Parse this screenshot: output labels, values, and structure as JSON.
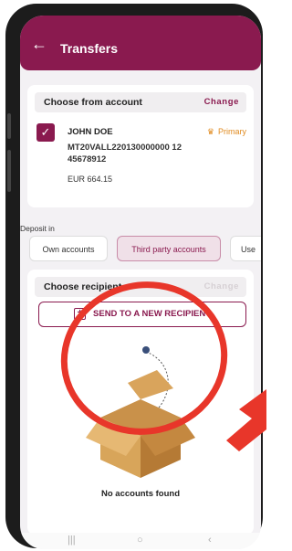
{
  "header": {
    "title": "Transfers"
  },
  "from_account": {
    "section_title": "Choose from account",
    "change_label": "Change",
    "name": "JOHN DOE",
    "iban": "MT20VALL220130000000 1245678912",
    "balance": "EUR 664.15",
    "primary_label": "Primary"
  },
  "deposit": {
    "label": "Deposit in",
    "tabs": [
      "Own accounts",
      "Third party accounts",
      "Use"
    ],
    "active_tab": "Third party accounts"
  },
  "recipient": {
    "section_title": "Choose recipient",
    "change_label": "Change",
    "send_label": "SEND TO A NEW RECIPIENT",
    "empty_text": "No accounts found"
  },
  "icons": [
    "back-arrow-icon",
    "checkmark-icon",
    "crown-icon",
    "plus-icon",
    "empty-box-icon"
  ],
  "colors": {
    "brand": "#8a1a4f",
    "accent": "#e08a1e",
    "annotation": "#e8362a"
  }
}
